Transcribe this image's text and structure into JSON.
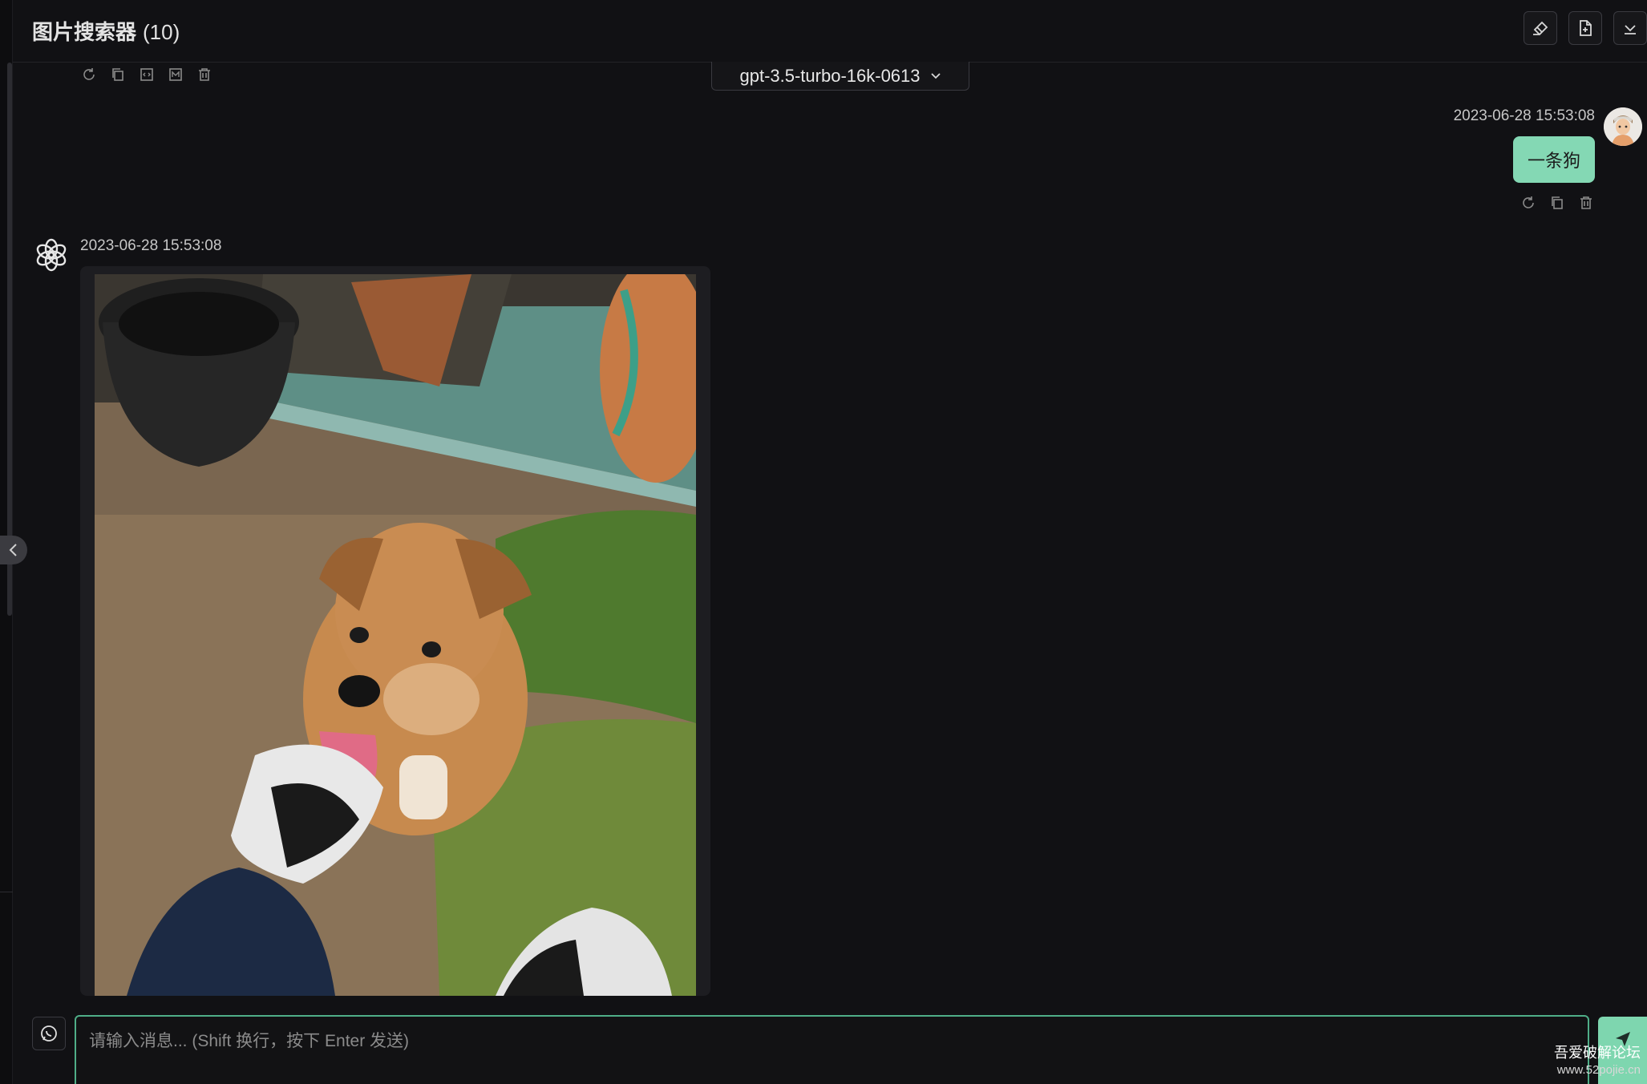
{
  "header": {
    "title": "图片搜索器",
    "count": "(10)",
    "actions": [
      "clear-icon",
      "export-icon",
      "collapse-down-icon"
    ]
  },
  "toolbar_icons": [
    "reload-icon",
    "copy-icon",
    "code-icon",
    "markdown-icon",
    "delete-icon"
  ],
  "model_selector": {
    "value": "gpt-3.5-turbo-16k-0613"
  },
  "messages": [
    {
      "role": "user",
      "time": "2023-06-28 15:53:08",
      "text": "一条狗",
      "actions": [
        "reload-icon",
        "copy-icon",
        "delete-icon"
      ]
    },
    {
      "role": "assistant",
      "time": "2023-06-28 15:53:08",
      "content": "image"
    }
  ],
  "composer": {
    "placeholder": "请输入消息... (Shift 换行，按下 Enter 发送)"
  },
  "watermark": {
    "name": "吾爱破解论坛",
    "url": "www.52pojie.cn"
  },
  "colors": {
    "accent": "#84d8b4",
    "background": "#111114",
    "input_border": "#4fae88"
  }
}
